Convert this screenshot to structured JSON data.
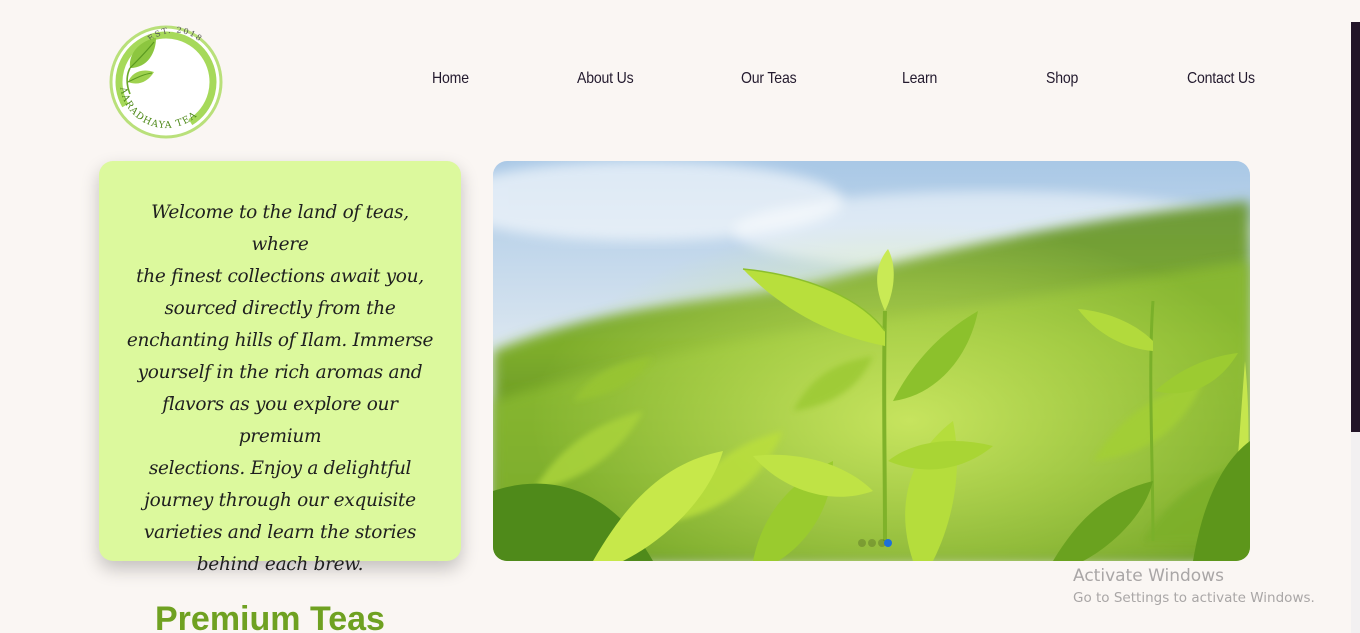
{
  "logo": {
    "top_text": "EST. 2018",
    "brand_text": "AARADHAYA TEA",
    "icon": "tea-leaf-icon"
  },
  "nav": {
    "items": [
      {
        "label": "Home"
      },
      {
        "label": "About Us"
      },
      {
        "label": "Our Teas"
      },
      {
        "label": "Learn"
      },
      {
        "label": "Shop"
      },
      {
        "label": "Contact Us"
      }
    ]
  },
  "welcome": {
    "lines": [
      "Welcome to the land of teas, where",
      "the finest collections await you,",
      "sourced directly from the",
      "enchanting hills of Ilam. Immerse",
      "yourself in the rich aromas and",
      "flavors as you explore our premium",
      "selections. Enjoy a delightful",
      "journey through our exquisite",
      "varieties and learn the stories",
      "behind each brew."
    ]
  },
  "hero": {
    "image": "tea-plantation-photo",
    "carousel": {
      "slide_count": 4,
      "active_index": 3
    }
  },
  "section": {
    "title": "Premium Teas"
  },
  "watermark": {
    "title": "Activate Windows",
    "subtitle": "Go to Settings to activate Windows."
  },
  "colors": {
    "background": "#faf6f3",
    "card": "#dcf99d",
    "accent_green": "#6fa121",
    "nav_text": "#231a2e",
    "dot_active": "#1e6fd9"
  }
}
